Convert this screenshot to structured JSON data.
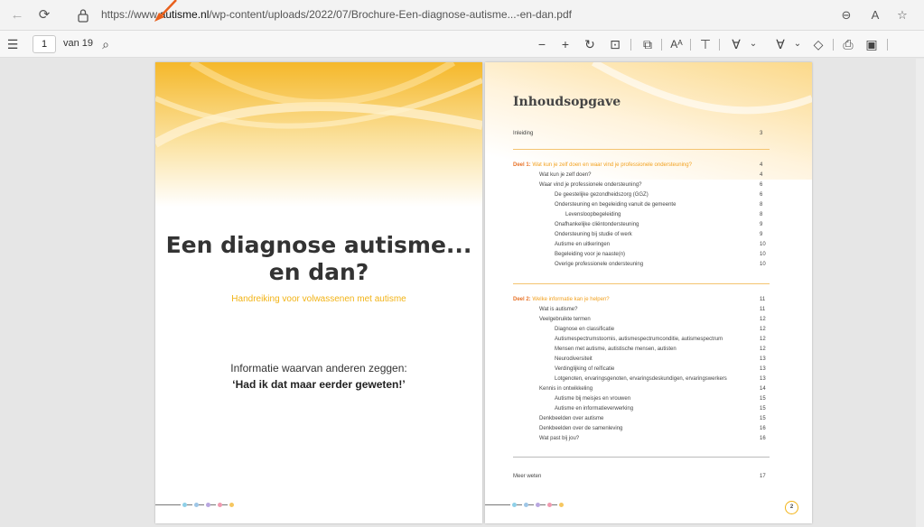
{
  "browser": {
    "url_prefix": "https://www.",
    "url_host": "autisme.nl",
    "url_path": "/wp-content/uploads/2022/07/Brochure-Een-diagnose-autisme...-en-dan.pdf",
    "icons": [
      "back-arrow-icon",
      "refresh-icon",
      "lock-icon",
      "zoom-icon",
      "read-aloud-icon",
      "favorites-icon"
    ]
  },
  "pdf_toolbar": {
    "current_page": "1",
    "page_total": "van 19",
    "icons": [
      "contents-icon",
      "search-icon",
      "zoom-out-icon",
      "zoom-in-icon",
      "rotate-icon",
      "fit-page-icon",
      "page-view-icon",
      "read-aloud-icon",
      "text-icon",
      "draw-icon",
      "highlight-icon",
      "erase-icon",
      "print-icon",
      "save-icon"
    ]
  },
  "cover": {
    "title_line1": "Een diagnose autisme...",
    "title_line2": "en dan?",
    "subtitle": "Handreiking voor volwassenen met autisme",
    "intro_line1": "Informatie waarvan anderen zeggen:",
    "intro_line2": "‘Had ik dat maar eerder geweten!’"
  },
  "toc": {
    "title": "Inhoudsopgave",
    "page_number": "2",
    "entries": [
      {
        "label": "Inleiding",
        "page": "3",
        "level": 0
      },
      {
        "prefix": "Deel 1:",
        "label": "Wat kun je zelf doen en waar vind je professionele ondersteuning?",
        "page": "4",
        "level": "deel"
      },
      {
        "label": "Wat kun je zelf doen?",
        "page": "4",
        "level": 1
      },
      {
        "label": "Waar vind je professionele ondersteuning?",
        "page": "6",
        "level": 1
      },
      {
        "label": "De geestelijke gezondheidszorg (GGZ)",
        "page": "6",
        "level": 2
      },
      {
        "label": "Ondersteuning en begeleiding vanuit de gemeente",
        "page": "8",
        "level": 2
      },
      {
        "label": "Levensloopbegeleiding",
        "page": "8",
        "level": 3
      },
      {
        "label": "Onafhankelijke cliëntondersteuning",
        "page": "9",
        "level": 2
      },
      {
        "label": "Ondersteuning bij studie of werk",
        "page": "9",
        "level": 2
      },
      {
        "label": "Autisme en uitkeringen",
        "page": "10",
        "level": 2
      },
      {
        "label": "Begeleiding voor je naaste(n)",
        "page": "10",
        "level": 2
      },
      {
        "label": "Overige professionele ondersteuning",
        "page": "10",
        "level": 2
      },
      {
        "prefix": "Deel 2:",
        "label": "Welke informatie kan je helpen?",
        "page": "11",
        "level": "deel"
      },
      {
        "label": "Wat is autisme?",
        "page": "11",
        "level": 1
      },
      {
        "label": "Veelgebruikte termen",
        "page": "12",
        "level": 1
      },
      {
        "label": "Diagnose en classificatie",
        "page": "12",
        "level": 2
      },
      {
        "label": "Autismespectrumstoornis, autismespectrumconditie, autismespectrum",
        "page": "12",
        "level": 2
      },
      {
        "label": "Mensen met autisme, autistische mensen, autisten",
        "page": "12",
        "level": 2
      },
      {
        "label": "Neurodiversiteit",
        "page": "13",
        "level": 2
      },
      {
        "label": "Verdinglijking of reïficatie",
        "page": "13",
        "level": 2
      },
      {
        "label": "Lotgenoten, ervaringsgenoten, ervaringsdeskundigen, ervaringswerkers",
        "page": "13",
        "level": 2
      },
      {
        "label": "Kennis in ontwikkeling",
        "page": "14",
        "level": 1
      },
      {
        "label": "Autisme bij meisjes en vrouwen",
        "page": "15",
        "level": 2
      },
      {
        "label": "Autisme en informatieverwerking",
        "page": "15",
        "level": 2
      },
      {
        "label": "Denkbeelden over autisme",
        "page": "15",
        "level": 1
      },
      {
        "label": "Denkbeelden over de samenleving",
        "page": "16",
        "level": 1
      },
      {
        "label": "Wat past bij jou?",
        "page": "16",
        "level": 1
      },
      {
        "label": "Meer weten",
        "page": "17",
        "level": 0
      }
    ]
  },
  "colors": {
    "accent_yellow": "#f2b316",
    "accent_orange": "#e8742a",
    "cursor_arrow": "#e8601c"
  }
}
